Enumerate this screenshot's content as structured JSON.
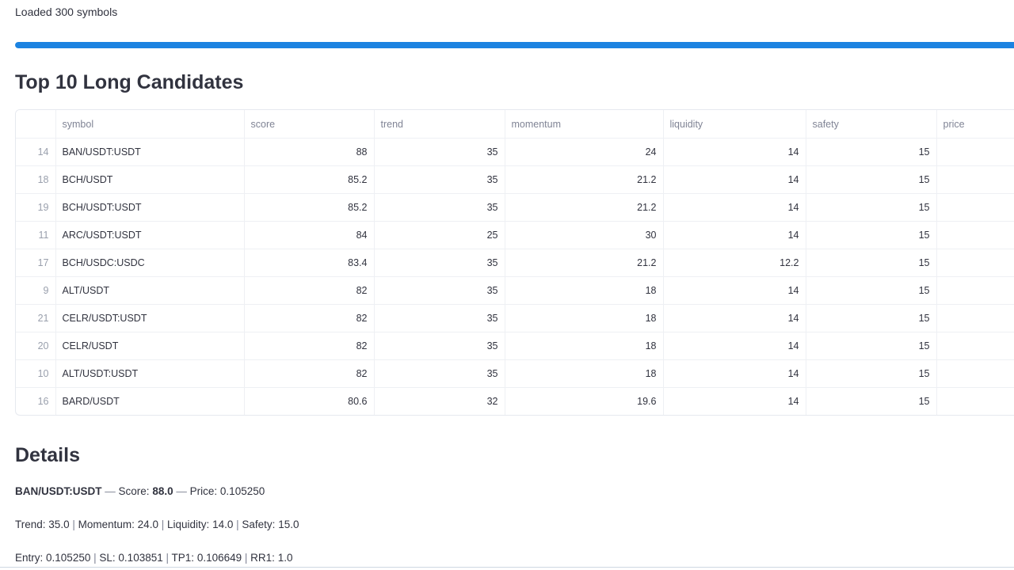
{
  "status": {
    "loaded_text": "Loaded 300 symbols",
    "progress_fraction": 1.0,
    "accent_color": "#1c83e1"
  },
  "top_section": {
    "title": "Top 10 Long Candidates"
  },
  "table": {
    "columns": [
      "",
      "symbol",
      "score",
      "trend",
      "momentum",
      "liquidity",
      "safety",
      "price"
    ],
    "rows": [
      {
        "idx": "14",
        "symbol": "BAN/USDT:USDT",
        "score": "88",
        "trend": "35",
        "momentum": "24",
        "liquidity": "14",
        "safety": "15",
        "price": ""
      },
      {
        "idx": "18",
        "symbol": "BCH/USDT",
        "score": "85.2",
        "trend": "35",
        "momentum": "21.2",
        "liquidity": "14",
        "safety": "15",
        "price": ""
      },
      {
        "idx": "19",
        "symbol": "BCH/USDT:USDT",
        "score": "85.2",
        "trend": "35",
        "momentum": "21.2",
        "liquidity": "14",
        "safety": "15",
        "price": ""
      },
      {
        "idx": "11",
        "symbol": "ARC/USDT:USDT",
        "score": "84",
        "trend": "25",
        "momentum": "30",
        "liquidity": "14",
        "safety": "15",
        "price": ""
      },
      {
        "idx": "17",
        "symbol": "BCH/USDC:USDC",
        "score": "83.4",
        "trend": "35",
        "momentum": "21.2",
        "liquidity": "12.2",
        "safety": "15",
        "price": ""
      },
      {
        "idx": "9",
        "symbol": "ALT/USDT",
        "score": "82",
        "trend": "35",
        "momentum": "18",
        "liquidity": "14",
        "safety": "15",
        "price": ""
      },
      {
        "idx": "21",
        "symbol": "CELR/USDT:USDT",
        "score": "82",
        "trend": "35",
        "momentum": "18",
        "liquidity": "14",
        "safety": "15",
        "price": ""
      },
      {
        "idx": "20",
        "symbol": "CELR/USDT",
        "score": "82",
        "trend": "35",
        "momentum": "18",
        "liquidity": "14",
        "safety": "15",
        "price": ""
      },
      {
        "idx": "10",
        "symbol": "ALT/USDT:USDT",
        "score": "82",
        "trend": "35",
        "momentum": "18",
        "liquidity": "14",
        "safety": "15",
        "price": ""
      },
      {
        "idx": "16",
        "symbol": "BARD/USDT",
        "score": "80.6",
        "trend": "32",
        "momentum": "19.6",
        "liquidity": "14",
        "safety": "15",
        "price": ""
      }
    ]
  },
  "details": {
    "title": "Details",
    "symbol": "BAN/USDT:USDT",
    "dash": "—",
    "score_label": "Score:",
    "score_value": "88.0",
    "price_label": "Price:",
    "price_value": "0.105250",
    "metrics_line": [
      {
        "label": "Trend:",
        "value": "35.0"
      },
      {
        "label": "Momentum:",
        "value": "24.0"
      },
      {
        "label": "Liquidity:",
        "value": "14.0"
      },
      {
        "label": "Safety:",
        "value": "15.0"
      }
    ],
    "levels_line": [
      {
        "label": "Entry:",
        "value": "0.105250"
      },
      {
        "label": "SL:",
        "value": "0.103851"
      },
      {
        "label": "TP1:",
        "value": "0.106649"
      },
      {
        "label": "RR1:",
        "value": "1.0"
      }
    ],
    "separator": "|"
  }
}
